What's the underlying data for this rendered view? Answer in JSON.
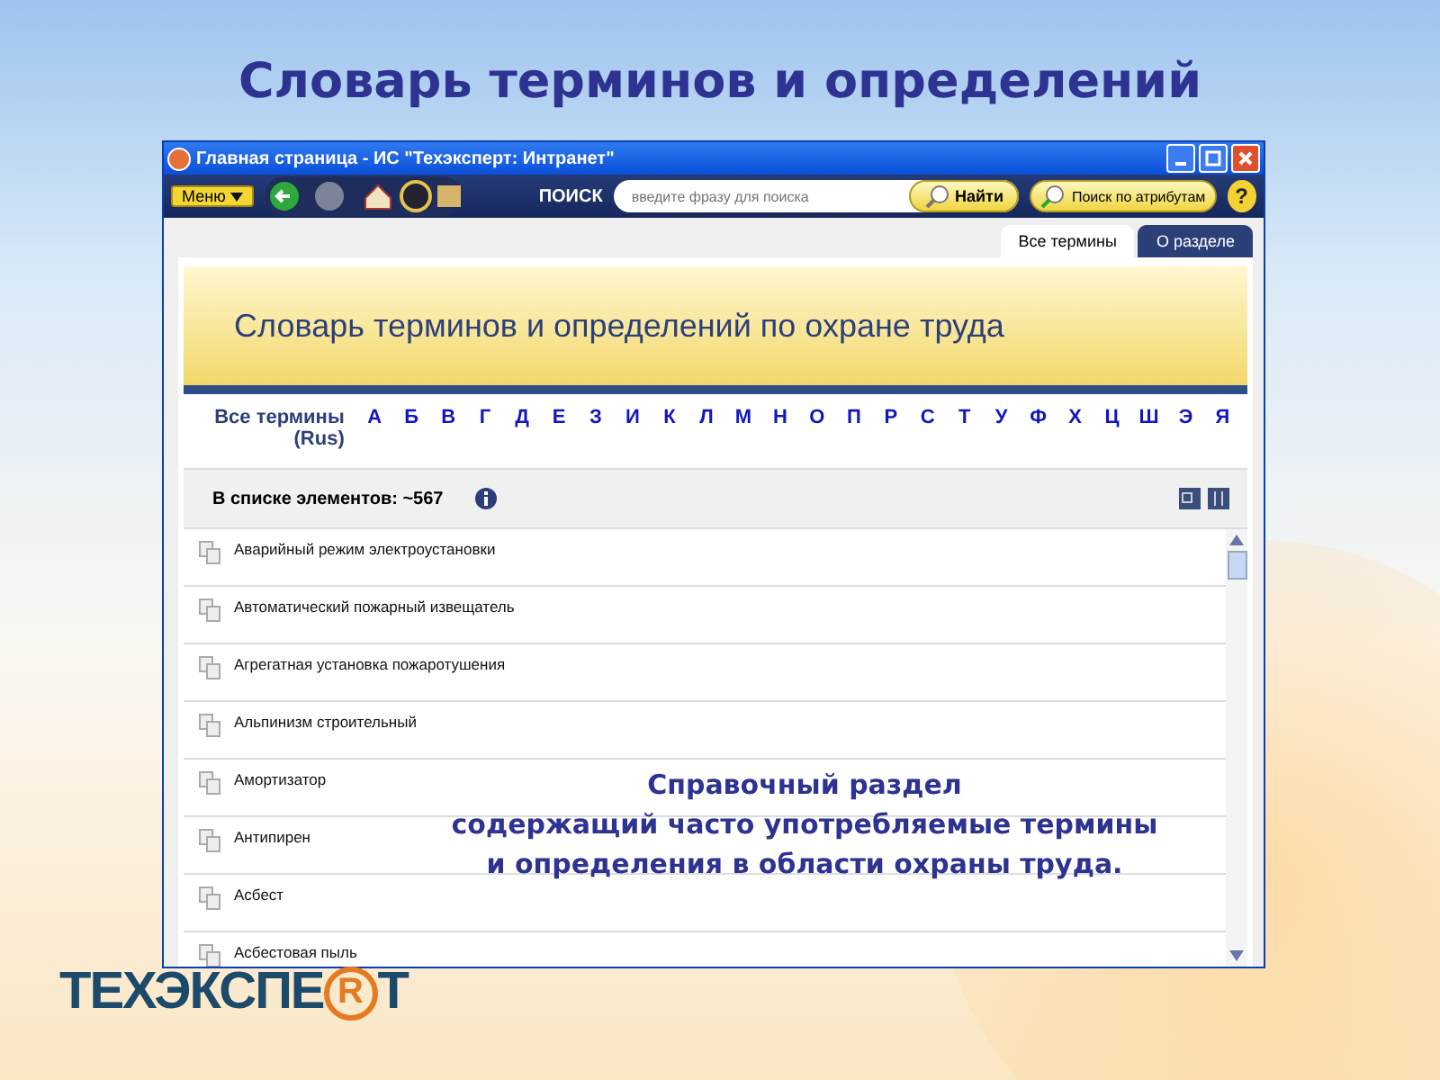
{
  "slide_title": "Словарь терминов и определений",
  "window": {
    "title": "Главная страница - ИС \"Техэксперт: Интранет\""
  },
  "toolbar": {
    "menu": "Меню",
    "search_label": "ПОИСК",
    "search_placeholder": "введите фразу для поиска",
    "find_button": "Найти",
    "attr_button": "Поиск по атрибутам",
    "help": "?"
  },
  "tabs": [
    {
      "label": "Все термины",
      "selected": true
    },
    {
      "label": "О разделе",
      "selected": false
    }
  ],
  "banner": "Словарь терминов и определений по охране труда",
  "alphabet": {
    "all_label": "Все термины (Rus)",
    "letters": [
      "А",
      "Б",
      "В",
      "Г",
      "Д",
      "Е",
      "З",
      "И",
      "К",
      "Л",
      "М",
      "Н",
      "О",
      "П",
      "Р",
      "С",
      "Т",
      "У",
      "Ф",
      "Х",
      "Ц",
      "Ш",
      "Э",
      "Я"
    ]
  },
  "count_label": "В списке элементов: ~567",
  "terms": [
    "Аварийный режим электроустановки",
    "Автоматический пожарный извещатель",
    "Агрегатная установка пожаротушения",
    "Альпинизм строительный",
    "Амортизатор",
    "Антипирен",
    "Асбест",
    "Асбестовая пыль"
  ],
  "caption": [
    "Справочный раздел",
    "содержащий часто употребляемые термины",
    "и определения в области охраны труда."
  ],
  "logo": {
    "before": "ТЕХЭКСПЕ",
    "mark": "R",
    "after": "Т"
  }
}
